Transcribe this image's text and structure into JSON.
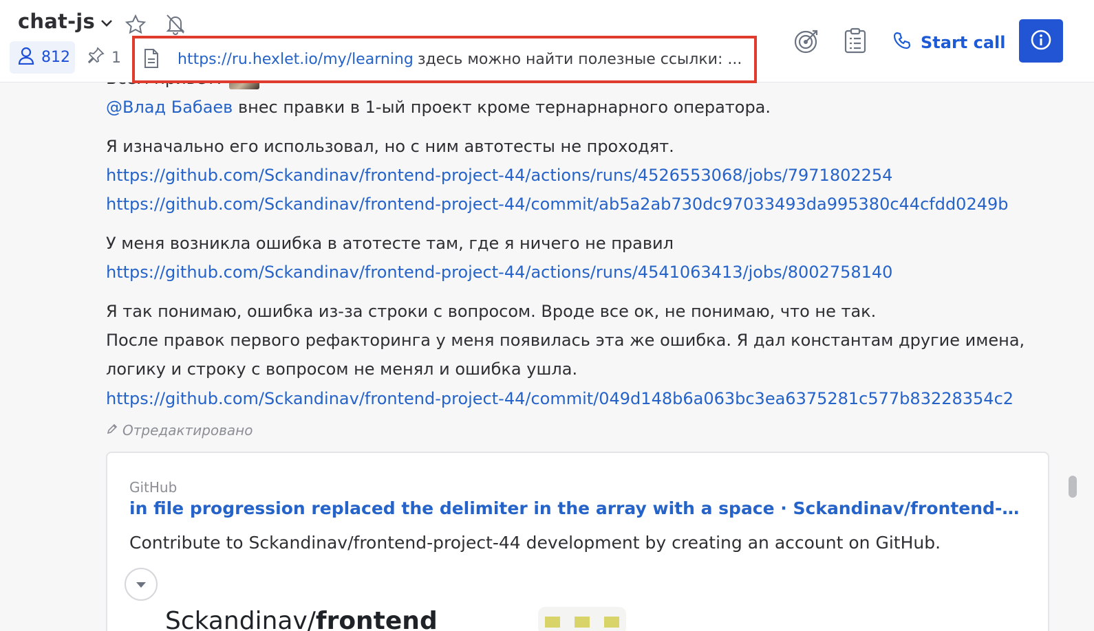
{
  "header": {
    "channel_name": "chat-js",
    "members_count": "812",
    "pins_count": "1",
    "pinned": {
      "link": "https://ru.hexlet.io/my/learning",
      "text": "здесь можно найти полезные ссылки: ..."
    },
    "start_call_label": "Start call"
  },
  "message": {
    "greeting": "Всем привет!",
    "mention": "@Влад Бабаев",
    "line1_rest": " внес правки в 1-ый проект кроме тернарнарного оператора.",
    "line2": "Я изначально его использовал, но с ним автотесты не проходят.",
    "link1": "https://github.com/Sckandinav/frontend-project-44/actions/runs/4526553068/jobs/7971802254",
    "link2": "https://github.com/Sckandinav/frontend-project-44/commit/ab5a2ab730dc97033493da995380c44cfdd0249b",
    "line3": "У меня возникла ошибка в атотесте там, где я ничего не правил",
    "link3": "https://github.com/Sckandinav/frontend-project-44/actions/runs/4541063413/jobs/8002758140",
    "line4": "Я так понимаю, ошибка из-за строки с вопросом. Вроде все ок,  не понимаю, что не так.",
    "line5": "После правок первого рефакторинга у меня появилась эта же ошибка. Я дал константам другие имена,",
    "line6": "логику и строку с вопросом не менял и ошибка ушла.",
    "link4": "https://github.com/Sckandinav/frontend-project-44/commit/049d148b6a063bc3ea6375281c577b83228354c2",
    "edited_label": "Отредактировано"
  },
  "preview": {
    "site": "GitHub",
    "title": "in file progression replaced the delimiter in the array with a space · Sckandinav/frontend-proje...",
    "description": "Contribute to Sckandinav/frontend-project-44 development by creating an account on GitHub.",
    "og_owner": "Sckandinav/",
    "og_repo": "frontend"
  },
  "colors": {
    "accent": "#2155d4",
    "link": "#2563c9",
    "highlight_border": "#e03c2e"
  },
  "icons": [
    "chevron-down-icon",
    "star-icon",
    "bell-off-icon",
    "user-icon",
    "pin-icon",
    "document-icon",
    "target-icon",
    "clipboard-icon",
    "phone-icon",
    "info-icon",
    "pencil-icon",
    "caret-down-icon"
  ]
}
